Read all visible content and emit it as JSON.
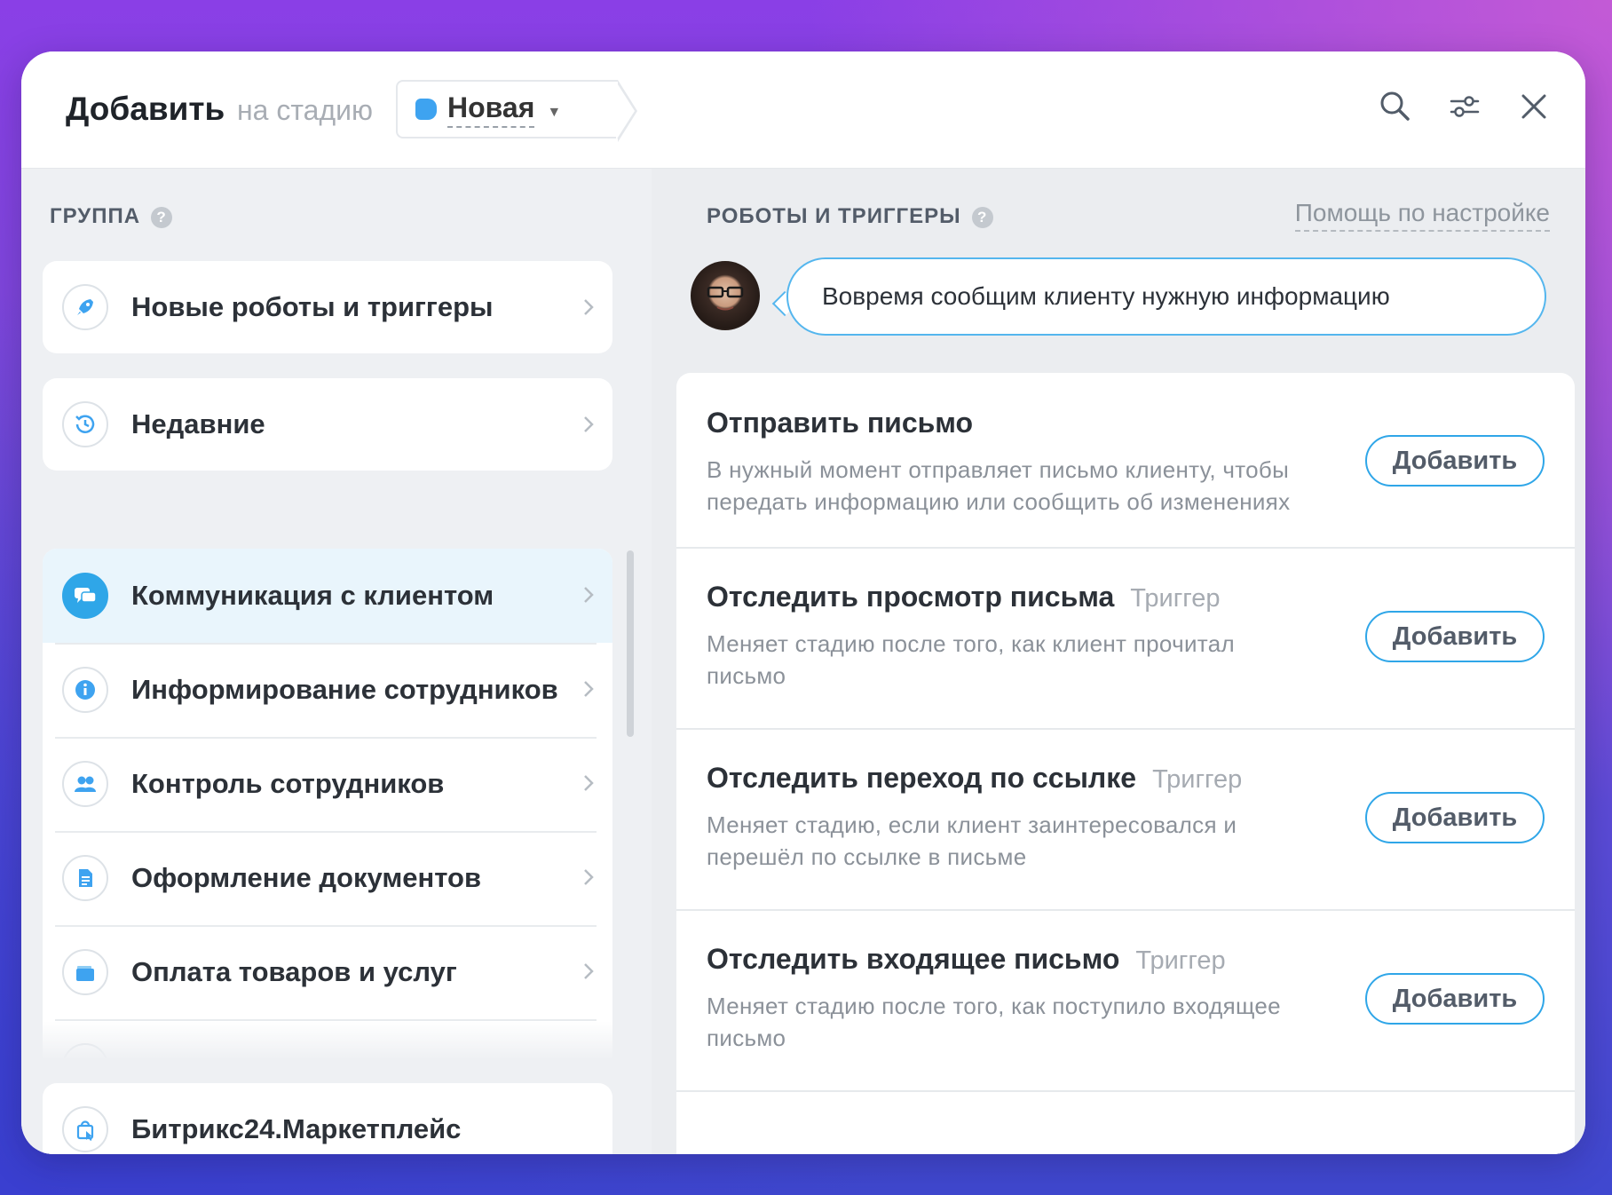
{
  "header": {
    "title": "Добавить",
    "subtitle": "на стадию",
    "stage": {
      "name": "Новая",
      "color": "#3ea3f0"
    },
    "icons": [
      "search-icon",
      "settings-sliders-icon",
      "close-icon"
    ]
  },
  "left": {
    "section_title": "ГРУППА",
    "top_items": [
      {
        "label": "Новые роботы и триггеры",
        "icon": "rocket-icon"
      },
      {
        "label": "Недавние",
        "icon": "history-icon"
      }
    ],
    "groups": [
      {
        "label": "Коммуникация с клиентом",
        "icon": "chat-icon",
        "active": true
      },
      {
        "label": "Информирование сотрудников",
        "icon": "info-icon"
      },
      {
        "label": "Контроль сотрудников",
        "icon": "users-icon"
      },
      {
        "label": "Оформление документов",
        "icon": "document-icon"
      },
      {
        "label": "Оплата товаров и услуг",
        "icon": "wallet-icon"
      }
    ],
    "marketplace": {
      "label": "Битрикс24.Маркетплейс",
      "icon": "shopping-bag-icon"
    }
  },
  "right": {
    "section_title": "РОБОТЫ И ТРИГГЕРЫ",
    "help_link": "Помощь по настройке",
    "assistant_message": "Вовремя сообщим клиенту нужную информацию",
    "add_label": "Добавить",
    "robots": [
      {
        "title": "Отправить письмо",
        "tag": "",
        "description": "В нужный момент отправляет письмо клиенту, чтобы передать информацию или сообщить об изменениях"
      },
      {
        "title": "Отследить просмотр письма",
        "tag": "Триггер",
        "description": "Меняет стадию после того, как клиент прочитал письмо"
      },
      {
        "title": "Отследить переход по ссылке",
        "tag": "Триггер",
        "description": "Меняет стадию, если клиент заинтересовался и перешёл по ссылке в письме"
      },
      {
        "title": "Отследить входящее письмо",
        "tag": "Триггер",
        "description": "Меняет стадию после того, как поступило входящее письмо"
      }
    ]
  },
  "colors": {
    "accent": "#2fa6e8",
    "active_bg": "#e9f5fc"
  }
}
